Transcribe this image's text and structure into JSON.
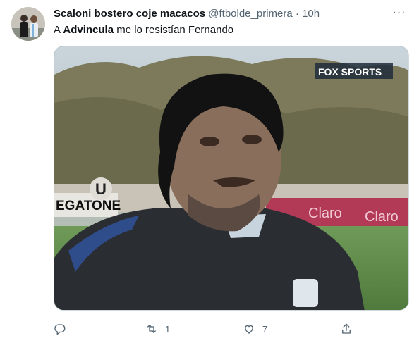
{
  "tweet": {
    "author_name": "Scaloni bostero coje macacos",
    "handle": "@ftbolde_primera",
    "separator": "·",
    "time": "10h",
    "more_label": "···",
    "text_prefix": "A ",
    "text_bold": "Advincula",
    "text_suffix": " me lo resistían Fernando"
  },
  "media": {
    "broadcaster_logo": "FOX SPORTS",
    "banner_text": "EGATONE",
    "pitch_board_text_1": "Claro",
    "pitch_board_text_2": "Claro",
    "overlay_badge": "U"
  },
  "actions": {
    "reply": {
      "icon": "reply-icon",
      "count": ""
    },
    "retweet": {
      "icon": "retweet-icon",
      "count": "1"
    },
    "like": {
      "icon": "heart-icon",
      "count": "7"
    },
    "share": {
      "icon": "share-icon",
      "count": ""
    }
  },
  "colors": {
    "meta_text": "#536471",
    "primary_text": "#0f1419",
    "border": "#cfd9de"
  }
}
